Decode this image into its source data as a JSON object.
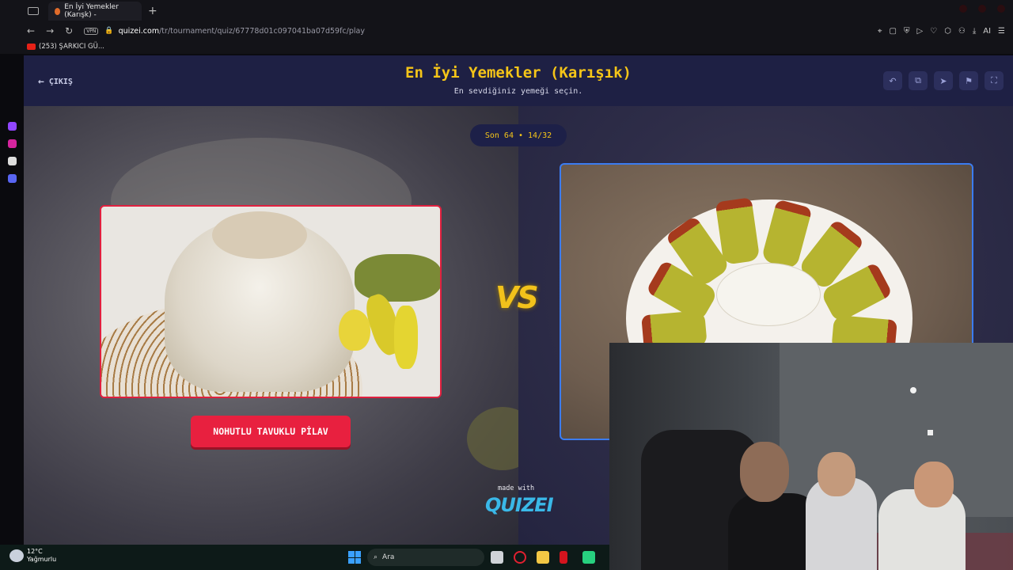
{
  "browser": {
    "tab_title": "En İyi Yemekler (Karışk) -",
    "new_tab": "+",
    "vpn_label": "VPN",
    "url_domain": "quizei.com",
    "url_path": "/tr/tournament/quiz/67778d01c097041ba07d59fc/play",
    "ai_label": "AI",
    "bookmark": "(253) ŞARKICI GÜ..."
  },
  "header": {
    "exit_label": "ÇIKIŞ",
    "title": "En İyi Yemekler (Karışık)",
    "subtitle": "En sevdiğiniz yemeği seçin.",
    "buttons": [
      "undo-icon",
      "copy-icon",
      "send-icon",
      "flag-icon",
      "fullscreen-icon"
    ]
  },
  "stage": {
    "round": "Son 64 • 14/32",
    "vs": "VS",
    "left_choice": "NOHUTLU TAVUKLU PİLAV",
    "made_with": "made with",
    "brand": "QUIZEI"
  },
  "taskbar": {
    "temp": "12°C",
    "weather": "Yağmurlu",
    "search_placeholder": "Ara"
  },
  "colors": {
    "accent_gold": "#f5c518",
    "choice_red": "#e8203f",
    "selected_blue": "#3b7cf0",
    "header_bg": "#1e2044"
  }
}
